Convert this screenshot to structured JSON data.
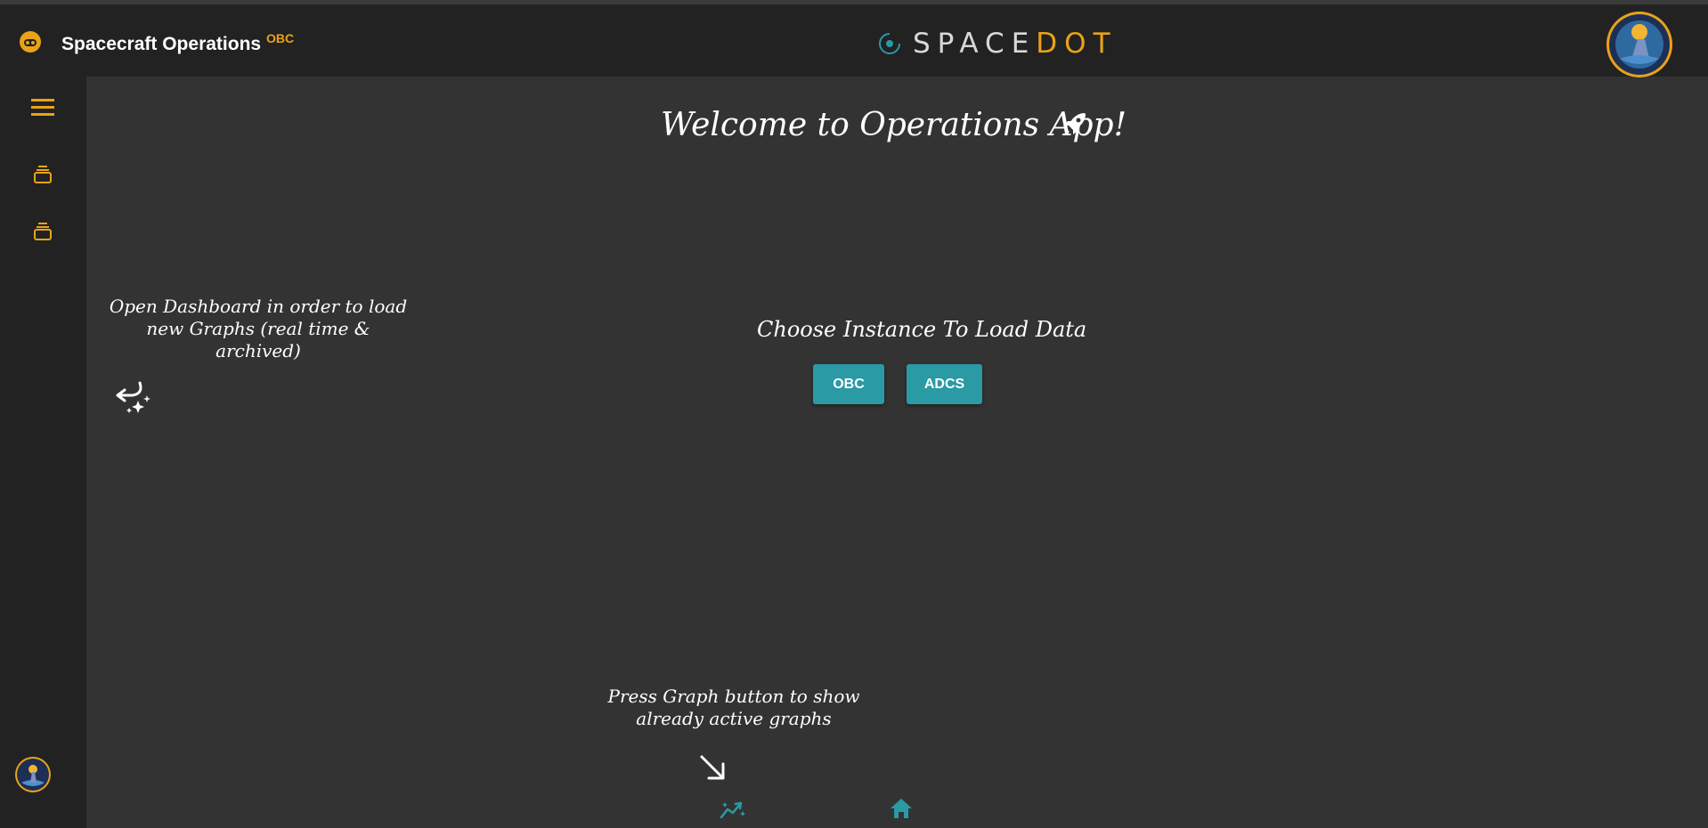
{
  "header": {
    "app_title": "Spacecraft Operations",
    "instance_badge": "OBC",
    "brand_primary": "SPACE",
    "brand_accent": "DOT",
    "app_icon": "robot-face-icon",
    "mission_logo": "mission-patch-logo"
  },
  "sidebar": {
    "items": [
      {
        "icon": "hamburger-menu-icon"
      },
      {
        "icon": "dashboard-stack-icon"
      },
      {
        "icon": "dashboard-stack-icon"
      }
    ],
    "avatar": "user-avatar"
  },
  "main": {
    "welcome_title": "Welcome to Operations App!",
    "rocket_icon": "rocket-icon",
    "dashboard_hint": "Open Dashboard in order to load new Graphs (real time & archived)",
    "choose_instance_label": "Choose Instance To Load Data",
    "instance_buttons": [
      {
        "label": "OBC"
      },
      {
        "label": "ADCS"
      }
    ],
    "graph_hint": "Press Graph button to show already active graphs",
    "bottom_nav": [
      {
        "icon": "graph-icon"
      },
      {
        "icon": "home-icon"
      }
    ]
  },
  "colors": {
    "accent": "#e8a317",
    "teal": "#2a9aa5",
    "background": "#333333",
    "panel": "#222222"
  }
}
